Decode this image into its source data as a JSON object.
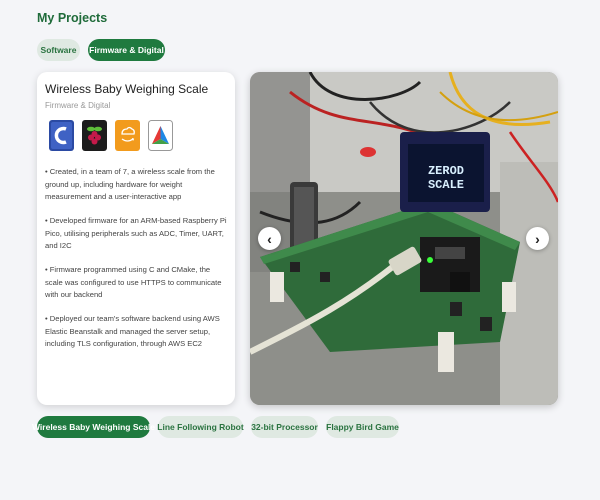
{
  "page": {
    "title": "My Projects"
  },
  "categories": [
    {
      "label": "Software",
      "active": false
    },
    {
      "label": "Firmware & Digital",
      "active": true
    }
  ],
  "project": {
    "title": "Wireless Baby Weighing Scale",
    "subtitle": "Firmware & Digital",
    "tech_icons": [
      "c-language-icon",
      "raspberry-pi-icon",
      "aws-icon",
      "cmake-icon"
    ],
    "bullets": [
      "• Created, in a team of 7, a wireless scale from the ground up, including hardware for weight measurement and a user-interactive app",
      "• Developed firmware for an ARM-based Raspberry Pi Pico, utilising peripherals such as ADC, Timer, UART, and I2C",
      "• Firmware programmed using C and CMake, the scale was configured to use HTTPS to communicate with our backend",
      "• Deployed our team's software backend using AWS Elastic Beanstalk and managed the server setup, including TLS configuration, through AWS EC2"
    ]
  },
  "photo": {
    "oled_text_1": "ZEROD",
    "oled_text_2": "SCALE"
  },
  "gallery_nav": {
    "prev": "‹",
    "next": "›"
  },
  "project_tabs": [
    {
      "label": "Wireless Baby Weighing Scale",
      "active": true
    },
    {
      "label": "Line Following Robot",
      "active": false
    },
    {
      "label": "32-bit Processor",
      "active": false
    },
    {
      "label": "Flappy Bird Game",
      "active": false
    }
  ],
  "colors": {
    "accent": "#1f7a3f",
    "accent_light": "#dfe9e2",
    "title": "#1f6b3a"
  }
}
